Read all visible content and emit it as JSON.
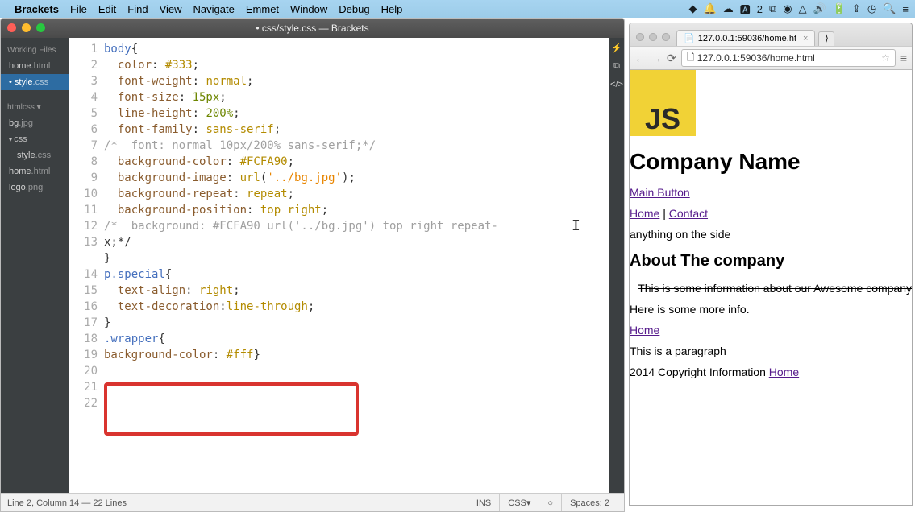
{
  "menubar": {
    "app": "Brackets",
    "items": [
      "File",
      "Edit",
      "Find",
      "View",
      "Navigate",
      "Emmet",
      "Window",
      "Debug",
      "Help"
    ]
  },
  "brackets": {
    "title": "• css/style.css — Brackets",
    "sidebar": {
      "working_title": "Working Files",
      "working": [
        {
          "name": "home",
          "ext": ".html",
          "active": false,
          "modified": false
        },
        {
          "name": "style",
          "ext": ".css",
          "active": true,
          "modified": true
        }
      ],
      "project": "htmlcss",
      "tree": [
        {
          "name": "bg",
          "ext": ".jpg",
          "indent": 0,
          "folder": false
        },
        {
          "name": "css",
          "ext": "",
          "indent": 0,
          "folder": true
        },
        {
          "name": "style",
          "ext": ".css",
          "indent": 1,
          "folder": false
        },
        {
          "name": "home",
          "ext": ".html",
          "indent": 0,
          "folder": false
        },
        {
          "name": "logo",
          "ext": ".png",
          "indent": 0,
          "folder": false
        }
      ]
    },
    "code_lines": [
      {
        "n": 1,
        "t": [
          [
            "sel",
            "body"
          ],
          [
            "punc",
            "{"
          ]
        ]
      },
      {
        "n": 2,
        "t": [
          [
            "",
            "  "
          ],
          [
            "prop",
            "color"
          ],
          [
            "punc",
            ": "
          ],
          [
            "val",
            "#333"
          ],
          [
            "punc",
            ";"
          ]
        ]
      },
      {
        "n": 3,
        "t": [
          [
            "",
            "  "
          ],
          [
            "prop",
            "font-weight"
          ],
          [
            "punc",
            ": "
          ],
          [
            "val",
            "normal"
          ],
          [
            "punc",
            ";"
          ]
        ]
      },
      {
        "n": 4,
        "t": [
          [
            "",
            "  "
          ],
          [
            "prop",
            "font-size"
          ],
          [
            "punc",
            ": "
          ],
          [
            "num",
            "15px"
          ],
          [
            "punc",
            ";"
          ]
        ]
      },
      {
        "n": 5,
        "t": [
          [
            "",
            "  "
          ],
          [
            "prop",
            "line-height"
          ],
          [
            "punc",
            ": "
          ],
          [
            "num",
            "200%"
          ],
          [
            "punc",
            ";"
          ]
        ]
      },
      {
        "n": 6,
        "t": [
          [
            "",
            "  "
          ],
          [
            "prop",
            "font-family"
          ],
          [
            "punc",
            ": "
          ],
          [
            "val",
            "sans-serif"
          ],
          [
            "punc",
            ";"
          ]
        ]
      },
      {
        "n": 7,
        "t": [
          [
            "cmt",
            "/*  font: normal 10px/200% sans-serif;*/"
          ]
        ]
      },
      {
        "n": 8,
        "t": [
          [
            "",
            ""
          ]
        ]
      },
      {
        "n": 9,
        "t": [
          [
            "",
            "  "
          ],
          [
            "prop",
            "background-color"
          ],
          [
            "punc",
            ": "
          ],
          [
            "val",
            "#FCFA90"
          ],
          [
            "punc",
            ";"
          ]
        ]
      },
      {
        "n": 10,
        "t": [
          [
            "",
            "  "
          ],
          [
            "prop",
            "background-image"
          ],
          [
            "punc",
            ": "
          ],
          [
            "val",
            "url"
          ],
          [
            "punc",
            "("
          ],
          [
            "str",
            "'../bg.jpg'"
          ],
          [
            "punc",
            ");"
          ]
        ]
      },
      {
        "n": 11,
        "t": [
          [
            "",
            "  "
          ],
          [
            "prop",
            "background-repeat"
          ],
          [
            "punc",
            ": "
          ],
          [
            "val",
            "repeat"
          ],
          [
            "punc",
            ";"
          ]
        ]
      },
      {
        "n": 12,
        "t": [
          [
            "",
            "  "
          ],
          [
            "prop",
            "background-position"
          ],
          [
            "punc",
            ": "
          ],
          [
            "val",
            "top right"
          ],
          [
            "punc",
            ";"
          ]
        ]
      },
      {
        "n": 13,
        "t": [
          [
            "cmt",
            "/*  background: #FCFA90 url('../bg.jpg') top right repeat-\nx;*/"
          ]
        ]
      },
      {
        "n": 14,
        "t": [
          [
            "punc",
            "}"
          ]
        ]
      },
      {
        "n": 15,
        "t": [
          [
            "",
            ""
          ]
        ]
      },
      {
        "n": 16,
        "t": [
          [
            "sel",
            "p.special"
          ],
          [
            "punc",
            "{"
          ]
        ]
      },
      {
        "n": 17,
        "t": [
          [
            "",
            "  "
          ],
          [
            "prop",
            "text-align"
          ],
          [
            "punc",
            ": "
          ],
          [
            "val",
            "right"
          ],
          [
            "punc",
            ";"
          ]
        ]
      },
      {
        "n": 18,
        "t": [
          [
            "",
            "  "
          ],
          [
            "prop",
            "text-decoration"
          ],
          [
            "punc",
            ":"
          ],
          [
            "val",
            "line-through"
          ],
          [
            "punc",
            ";"
          ]
        ]
      },
      {
        "n": 19,
        "t": [
          [
            "punc",
            "}"
          ]
        ]
      },
      {
        "n": 20,
        "t": [
          [
            "",
            ""
          ]
        ]
      },
      {
        "n": 21,
        "t": [
          [
            "sel",
            ".wrapper"
          ],
          [
            "punc",
            "{"
          ]
        ]
      },
      {
        "n": 22,
        "t": [
          [
            "prop",
            "background-color"
          ],
          [
            "punc",
            ": "
          ],
          [
            "val",
            "#fff"
          ],
          [
            "punc",
            "}"
          ]
        ]
      }
    ],
    "status": {
      "left": "Line 2, Column 14 — 22 Lines",
      "ins": "INS",
      "lang": "CSS",
      "spaces": "Spaces: 2"
    }
  },
  "browser": {
    "tab_title": "127.0.0.1:59036/home.ht",
    "url_display": "127.0.0.1:59036/home.html",
    "page": {
      "logo_text": "JS",
      "h1": "Company Name",
      "main_button": "Main Button",
      "nav_home": "Home",
      "nav_sep": " | ",
      "nav_contact": "Contact",
      "aside": "anything on the side",
      "h2": "About The company",
      "p_strike": "This is some information about our Awesome company",
      "p2": "Here is some more info.",
      "link_home": "Home",
      "p3": "This is a paragraph",
      "footer_text": "2014 Copyright Information ",
      "footer_link": "Home"
    }
  }
}
